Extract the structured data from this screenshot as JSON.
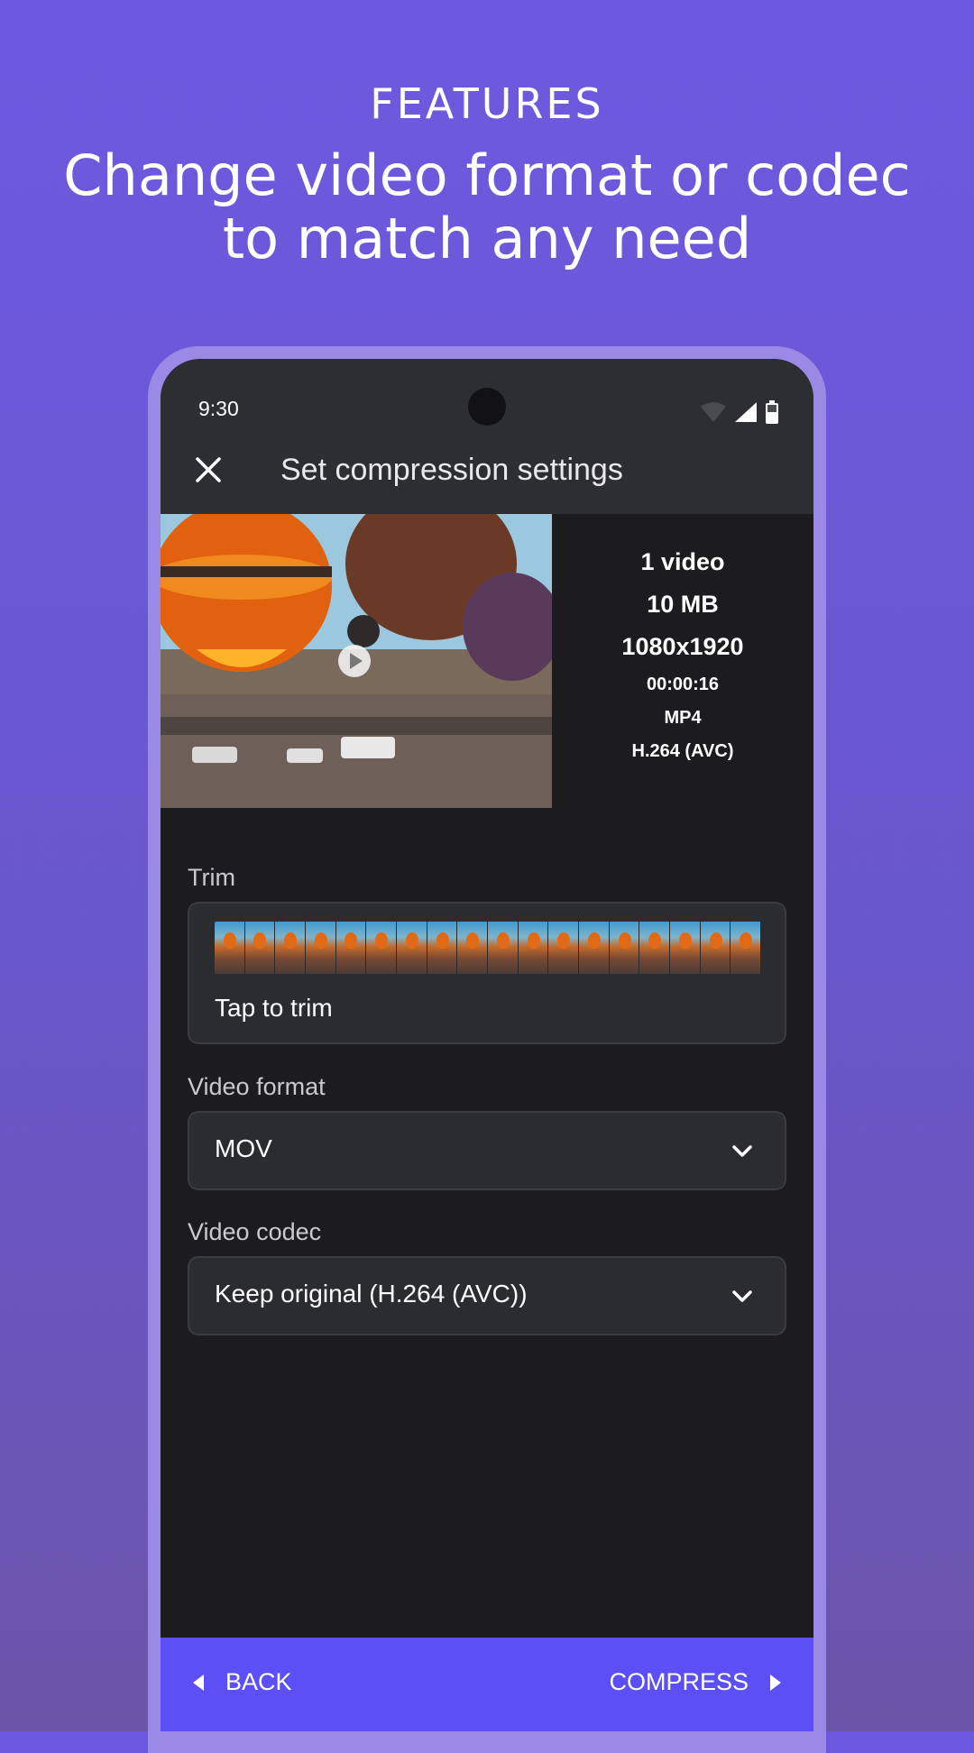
{
  "hero": {
    "eyebrow": "FEATURES",
    "headline_line1": "Change video format or codec",
    "headline_line2": "to match any need"
  },
  "statusbar": {
    "time": "9:30",
    "icons": [
      "wifi-icon",
      "signal-icon",
      "battery-icon"
    ]
  },
  "appbar": {
    "close_icon": "close-icon",
    "title": "Set compression settings"
  },
  "video_info": {
    "count": "1 video",
    "size": "10 MB",
    "resolution": "1080x1920",
    "duration": "00:00:16",
    "container": "MP4",
    "codec": "H.264 (AVC)"
  },
  "trim": {
    "label": "Trim",
    "action_text": "Tap to trim"
  },
  "video_format": {
    "label": "Video format",
    "selected": "MOV"
  },
  "video_codec": {
    "label": "Video codec",
    "selected": "Keep original (H.264 (AVC))"
  },
  "bottom_nav": {
    "back_label": "BACK",
    "compress_label": "COMPRESS"
  },
  "colors": {
    "background": "#6d59e0",
    "bottom_bar": "#5b4ff5",
    "surface": "#1c1c1f",
    "card": "#2b2c30"
  }
}
